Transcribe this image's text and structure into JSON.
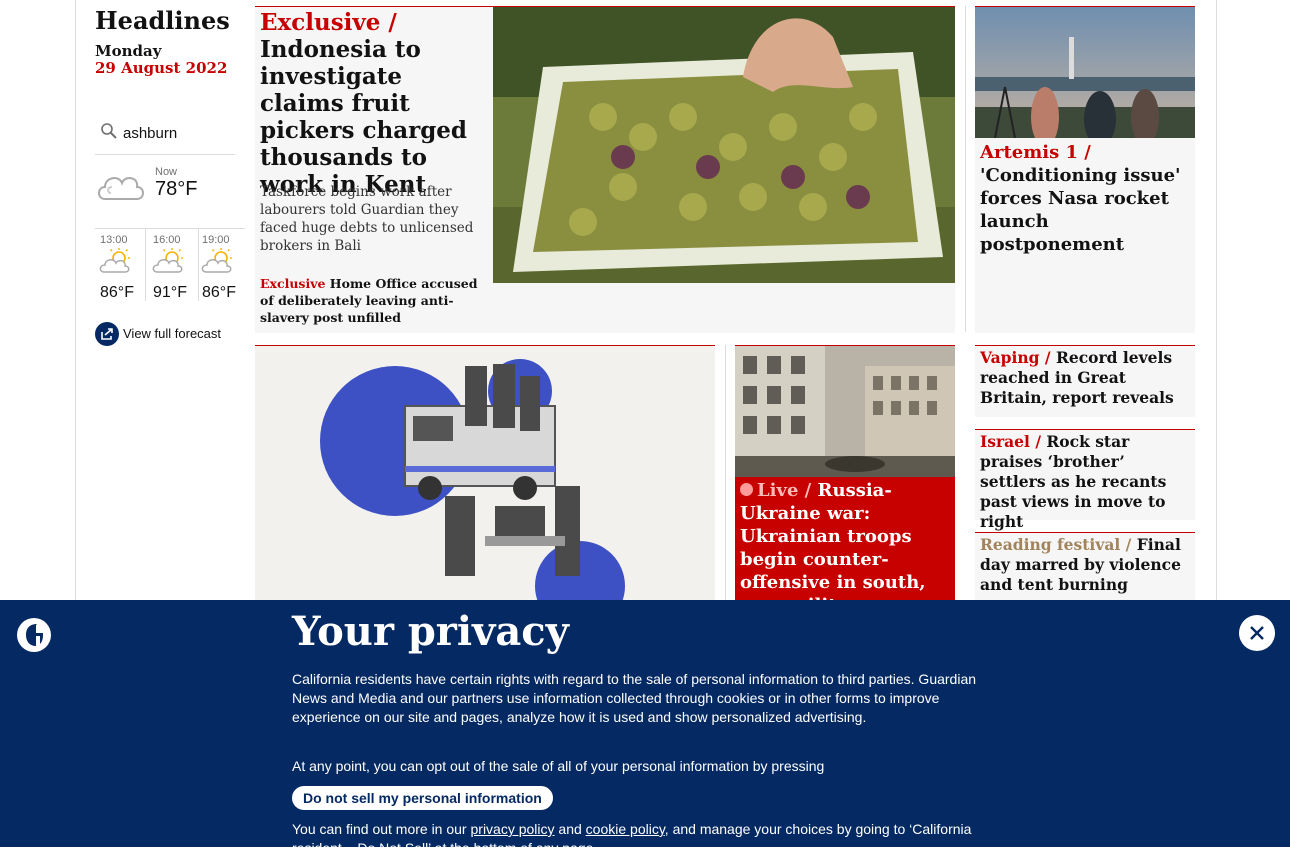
{
  "sidebar": {
    "title": "Headlines",
    "day": "Monday",
    "date": "29 August 2022",
    "search_value": "ashburn",
    "weather": {
      "now_label": "Now",
      "now_temp": "78°F",
      "now_icon": "cloudy-icon",
      "forecast": [
        {
          "time": "13:00",
          "temp": "86°F",
          "icon": "partly-sunny-icon"
        },
        {
          "time": "16:00",
          "temp": "91°F",
          "icon": "partly-sunny-icon"
        },
        {
          "time": "19:00",
          "temp": "86°F",
          "icon": "partly-sunny-icon"
        }
      ],
      "full_forecast_label": "View full forecast"
    }
  },
  "main_story": {
    "kicker": "Exclusive /",
    "headline": "Indonesia to investigate claims fruit pickers charged thousands to work in Kent",
    "standfirst": "Taskforce begins work after labourers told Guardian they faced huge debts to unlicensed brokers in Bali",
    "sublink_kicker": "Exclusive",
    "sublink_text": "Home Office accused of deliberately leaving anti-slavery post unfilled"
  },
  "artemis": {
    "kicker": "Artemis 1 /",
    "headline": "'Conditioning issue' forces Nasa rocket launch postponement"
  },
  "ukraine": {
    "kicker": "Live /",
    "headline": "Russia-Ukraine war: Ukrainian troops begin counter-offensive in south, says military command"
  },
  "small_stories": [
    {
      "kicker": "Vaping  /",
      "headline": "Record levels reached in Great Britain, report reveals"
    },
    {
      "kicker": "Israel /",
      "headline": "Rock star praises ‘brother’ settlers as he recants past views in move to right"
    },
    {
      "kicker": "Reading festival /",
      "headline": "Final day marred by violence and tent burning"
    }
  ],
  "privacy": {
    "title": "Your privacy",
    "p1": "California residents have certain rights with regard to the sale of personal information to third parties. Guardian News and Media and our partners use information collected through cookies or in other forms to improve experience on our site and pages, analyze how it is used and show personalized advertising.",
    "p2": "At any point, you can opt out of the sale of all of your personal information by pressing",
    "button": "Do not sell my personal information",
    "p3_a": "You can find out more in our ",
    "p3_link1": "privacy policy",
    "p3_b": " and ",
    "p3_link2": "cookie policy",
    "p3_c": ", and manage your choices by going to ‘California resident – Do Not Sell’ at the bottom of any page."
  },
  "colors": {
    "news_red": "#c70000",
    "guardian_blue": "#052962",
    "reading_gold": "#a1845c"
  }
}
